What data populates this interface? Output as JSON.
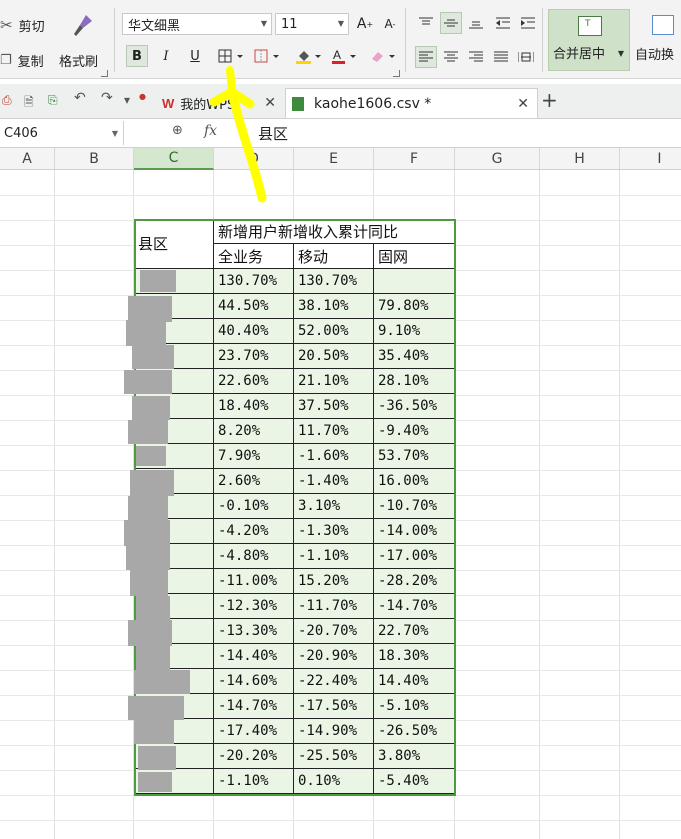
{
  "ribbon": {
    "cut_label": "剪切",
    "copy_label": "复制",
    "format_painter_label": "格式刷",
    "font_family": "华文细黑",
    "font_size": "11",
    "bold": "B",
    "italic": "I",
    "underline": "U",
    "merge_label": "合并居中",
    "wrap_label": "自动换"
  },
  "tabs": [
    {
      "label": "我的WPS"
    },
    {
      "label": "kaohe1606.csv *"
    }
  ],
  "formula_bar": {
    "cell_ref": "C406",
    "fx": "fx",
    "content": "县区"
  },
  "columns": [
    "A",
    "B",
    "C",
    "D",
    "E",
    "F",
    "G",
    "H",
    "I"
  ],
  "table": {
    "header_district": "县区",
    "header_group": "新增用户新增收入累计同比",
    "sub_headers": [
      "全业务",
      "移动",
      "固网"
    ],
    "rows": [
      [
        "130.70%",
        "130.70%",
        ""
      ],
      [
        "44.50%",
        "38.10%",
        "79.80%"
      ],
      [
        "40.40%",
        "52.00%",
        "9.10%"
      ],
      [
        "23.70%",
        "20.50%",
        "35.40%"
      ],
      [
        "22.60%",
        "21.10%",
        "28.10%"
      ],
      [
        "18.40%",
        "37.50%",
        "-36.50%"
      ],
      [
        "8.20%",
        "11.70%",
        "-9.40%"
      ],
      [
        "7.90%",
        "-1.60%",
        "53.70%"
      ],
      [
        "2.60%",
        "-1.40%",
        "16.00%"
      ],
      [
        "-0.10%",
        "3.10%",
        "-10.70%"
      ],
      [
        "-4.20%",
        "-1.30%",
        "-14.00%"
      ],
      [
        "-4.80%",
        "-1.10%",
        "-17.00%"
      ],
      [
        "-11.00%",
        "15.20%",
        "-28.20%"
      ],
      [
        "-12.30%",
        "-11.70%",
        "-14.70%"
      ],
      [
        "-13.30%",
        "-20.70%",
        "22.70%"
      ],
      [
        "-14.40%",
        "-20.90%",
        "18.30%"
      ],
      [
        "-14.60%",
        "-22.40%",
        "14.40%"
      ],
      [
        "-14.70%",
        "-17.50%",
        "-5.10%"
      ],
      [
        "-17.40%",
        "-14.90%",
        "-26.50%"
      ],
      [
        "-20.20%",
        "-25.50%",
        "3.80%"
      ],
      [
        "-1.10%",
        "0.10%",
        "-5.40%"
      ]
    ]
  },
  "colors": {
    "accent_green": "#4d9a3f",
    "cell_fill": "#eaf5e6",
    "annotation_arrow": "#ffff00"
  }
}
